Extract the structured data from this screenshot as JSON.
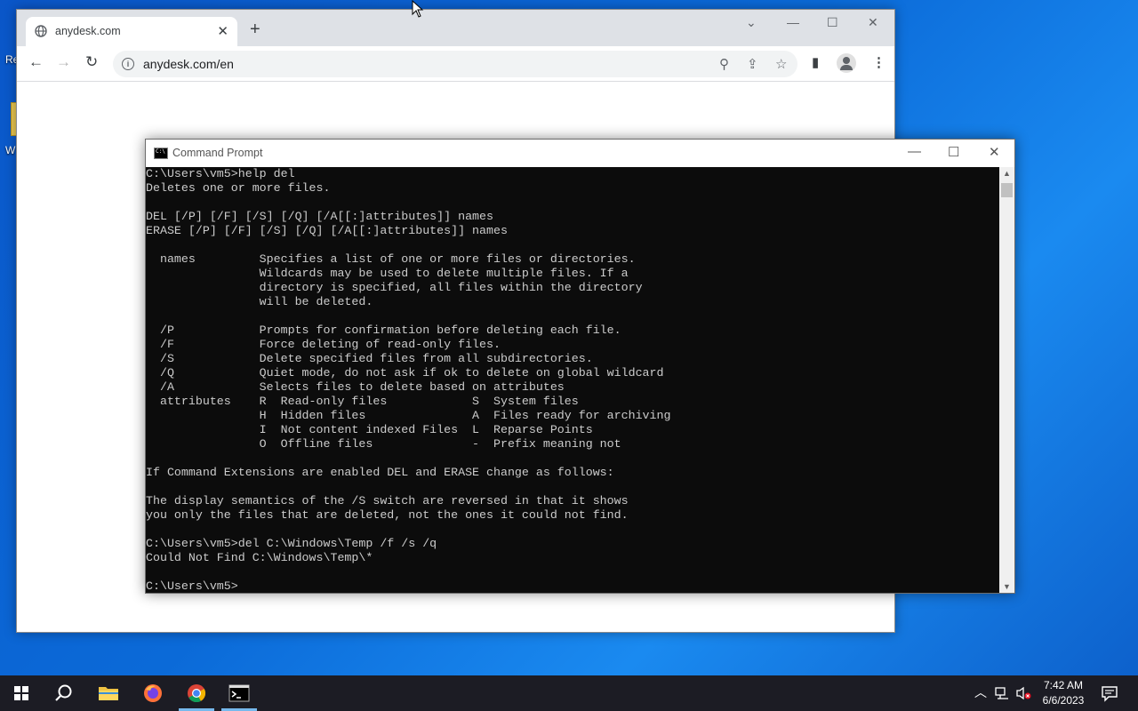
{
  "desktop": {
    "icons": [
      {
        "label": "Re",
        "icon": "recycle-bin-icon"
      },
      {
        "label": "W",
        "icon": "folder-icon"
      }
    ]
  },
  "browser": {
    "tab_title": "anydesk.com",
    "tab_icon": "globe-icon",
    "new_tab": "+",
    "url": "anydesk.com/en",
    "icons": {
      "back": "←",
      "forward": "→",
      "reload": "↻",
      "zoom": "⚲",
      "share": "⇪",
      "bookmark": "☆",
      "sidepanel": "▮",
      "menu": "⋮",
      "tab_close": "✕",
      "tab_search": "⌄",
      "minimize": "—",
      "maximize": "☐",
      "close": "✕"
    }
  },
  "cmd": {
    "title": "Command Prompt",
    "icons": {
      "minimize": "—",
      "maximize": "☐",
      "close": "✕"
    },
    "lines": [
      "C:\\Users\\vm5>help del",
      "Deletes one or more files.",
      "",
      "DEL [/P] [/F] [/S] [/Q] [/A[[:]attributes]] names",
      "ERASE [/P] [/F] [/S] [/Q] [/A[[:]attributes]] names",
      "",
      "  names         Specifies a list of one or more files or directories.",
      "                Wildcards may be used to delete multiple files. If a",
      "                directory is specified, all files within the directory",
      "                will be deleted.",
      "",
      "  /P            Prompts for confirmation before deleting each file.",
      "  /F            Force deleting of read-only files.",
      "  /S            Delete specified files from all subdirectories.",
      "  /Q            Quiet mode, do not ask if ok to delete on global wildcard",
      "  /A            Selects files to delete based on attributes",
      "  attributes    R  Read-only files            S  System files",
      "                H  Hidden files               A  Files ready for archiving",
      "                I  Not content indexed Files  L  Reparse Points",
      "                O  Offline files              -  Prefix meaning not",
      "",
      "If Command Extensions are enabled DEL and ERASE change as follows:",
      "",
      "The display semantics of the /S switch are reversed in that it shows",
      "you only the files that are deleted, not the ones it could not find.",
      "",
      "C:\\Users\\vm5>del C:\\Windows\\Temp /f /s /q",
      "Could Not Find C:\\Windows\\Temp\\*",
      "",
      "C:\\Users\\vm5>"
    ]
  },
  "taskbar": {
    "items": [
      {
        "name": "start",
        "icon": "windows-logo-icon"
      },
      {
        "name": "search",
        "icon": "search-icon"
      },
      {
        "name": "file-explorer",
        "icon": "folder-icon"
      },
      {
        "name": "firefox",
        "icon": "firefox-icon"
      },
      {
        "name": "chrome",
        "icon": "chrome-icon"
      },
      {
        "name": "command-prompt",
        "icon": "cmd-icon"
      }
    ],
    "tray": {
      "chevron": "︿",
      "time": "7:42 AM",
      "date": "6/6/2023"
    }
  },
  "colors": {
    "desktop_bg": "#0b6ad8",
    "console_bg": "#0c0c0c",
    "console_fg": "#cccccc",
    "taskbar_bg": "#1c1c24",
    "active_indicator": "#76b9ed"
  }
}
